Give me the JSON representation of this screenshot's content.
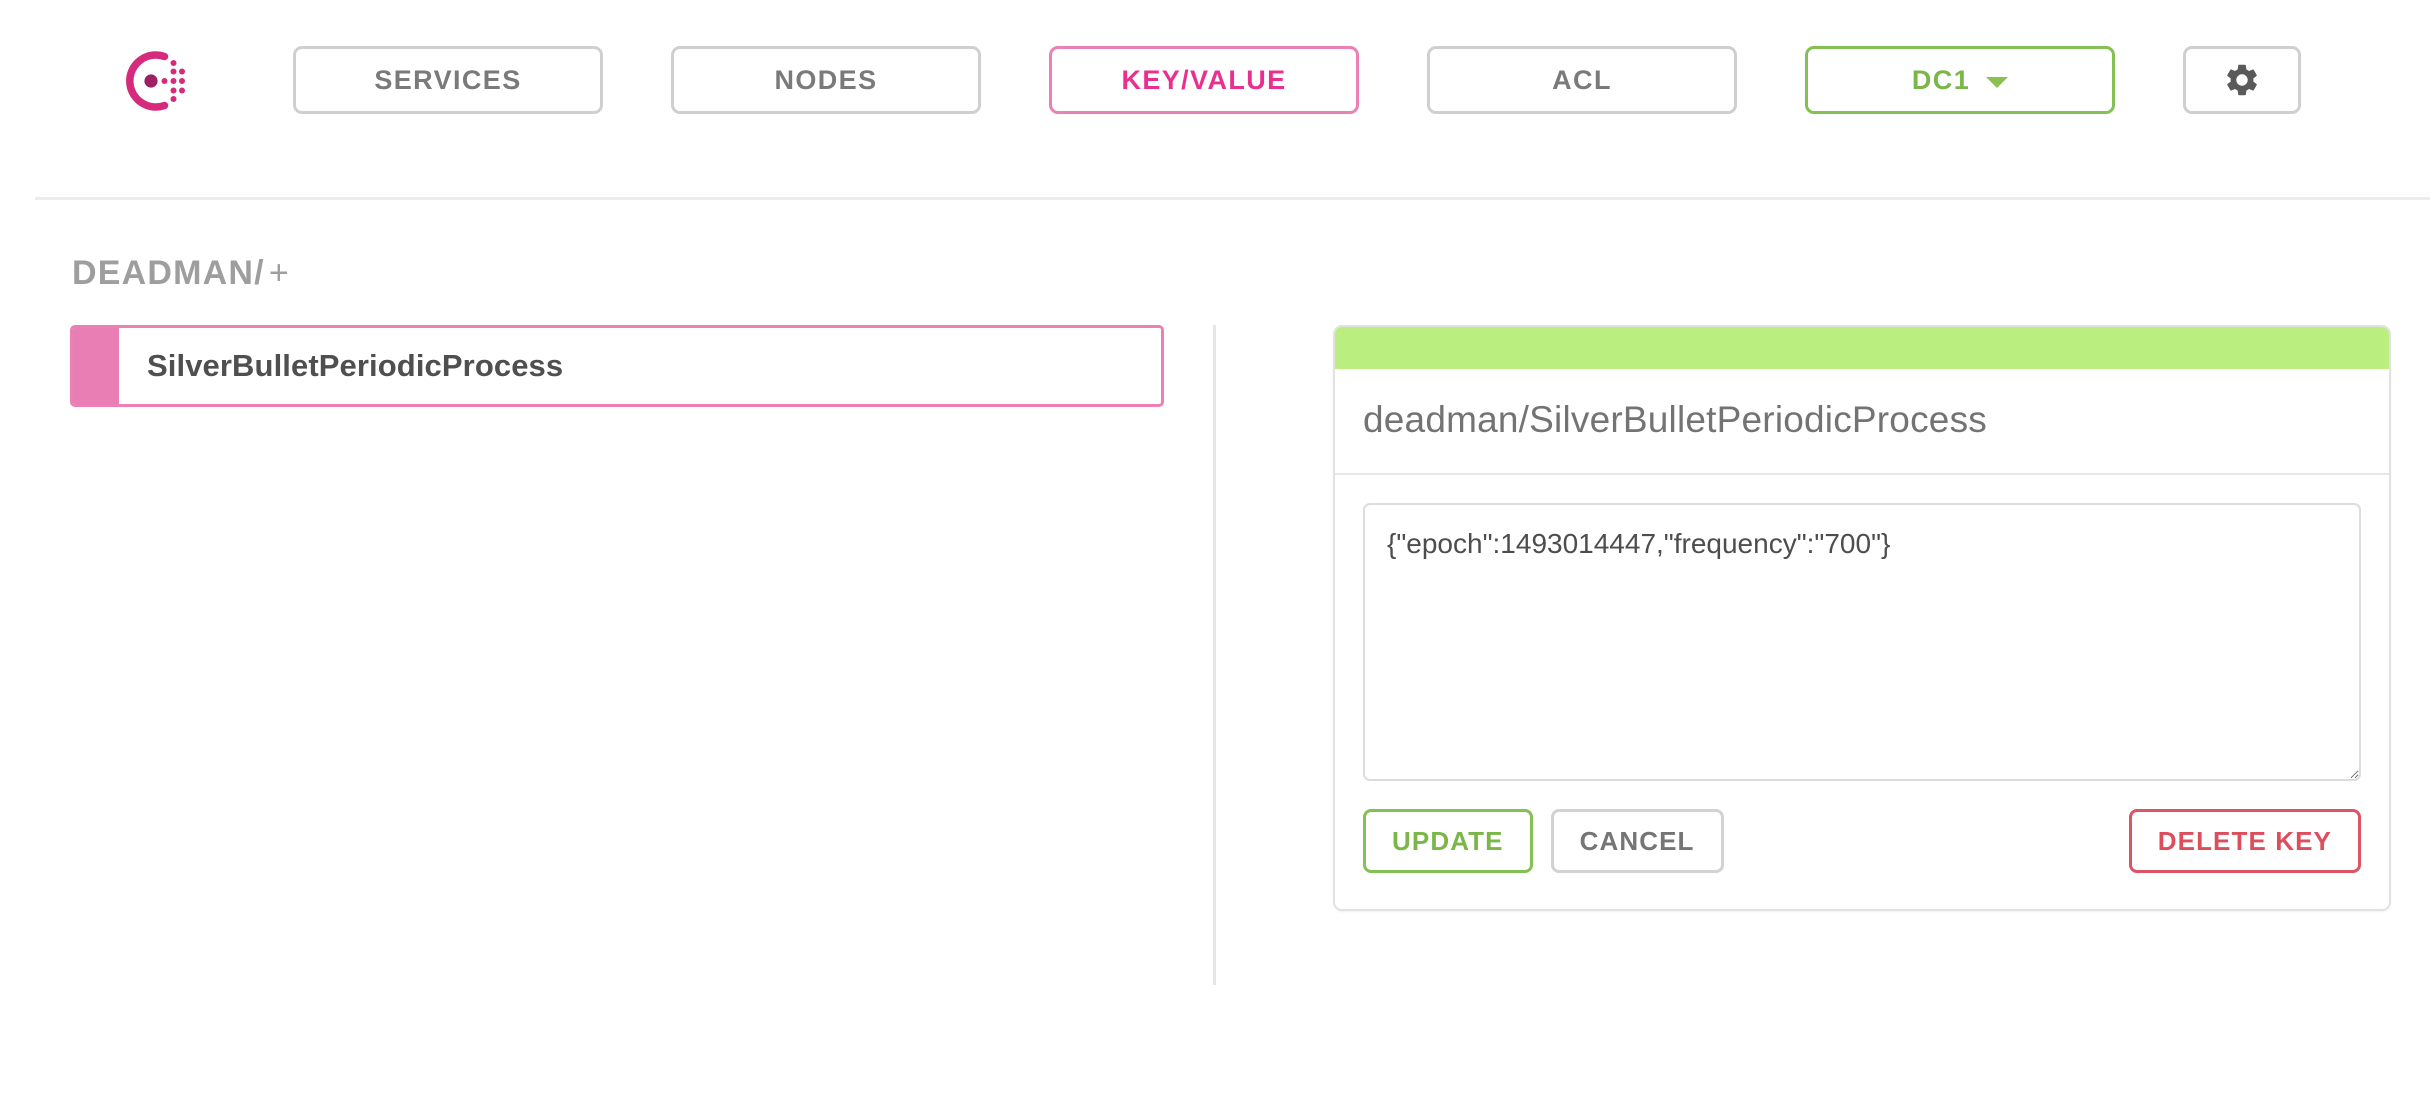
{
  "app": {
    "name": "Consul",
    "logo_icon": "consul-logo-icon"
  },
  "topnav": {
    "items": [
      {
        "label": "SERVICES",
        "state": "inactive",
        "icon": null
      },
      {
        "label": "NODES",
        "state": "inactive",
        "icon": null
      },
      {
        "label": "KEY/VALUE",
        "state": "active",
        "icon": null
      },
      {
        "label": "ACL",
        "state": "inactive",
        "icon": null
      }
    ],
    "datacenter": {
      "label": "DC1",
      "caret_icon": "chevron-down-icon",
      "state": "active"
    },
    "settings": {
      "icon": "gear-icon",
      "label": ""
    }
  },
  "breadcrumb": {
    "path": "DEADMAN/",
    "add_label": "+"
  },
  "key_list": {
    "items": [
      {
        "label": "SilverBulletPeriodicProcess",
        "selected": true
      }
    ]
  },
  "detail": {
    "flag_color": "#baef80",
    "title": "deadman/SilverBulletPeriodicProcess",
    "value": "{\"epoch\":1493014447,\"frequency\":\"700\"}",
    "value_placeholder": "Value",
    "actions": {
      "update_label": "UPDATE",
      "cancel_label": "CANCEL",
      "delete_label": "DELETE KEY"
    }
  },
  "colors": {
    "brand_pink": "#e8318f",
    "accent_pink": "#ec80b4",
    "accent_green": "#84c054",
    "flag_green": "#baef80",
    "danger_red": "#dd5565",
    "muted_gray": "#9e9e9e",
    "border_gray": "#cfcfd1"
  }
}
